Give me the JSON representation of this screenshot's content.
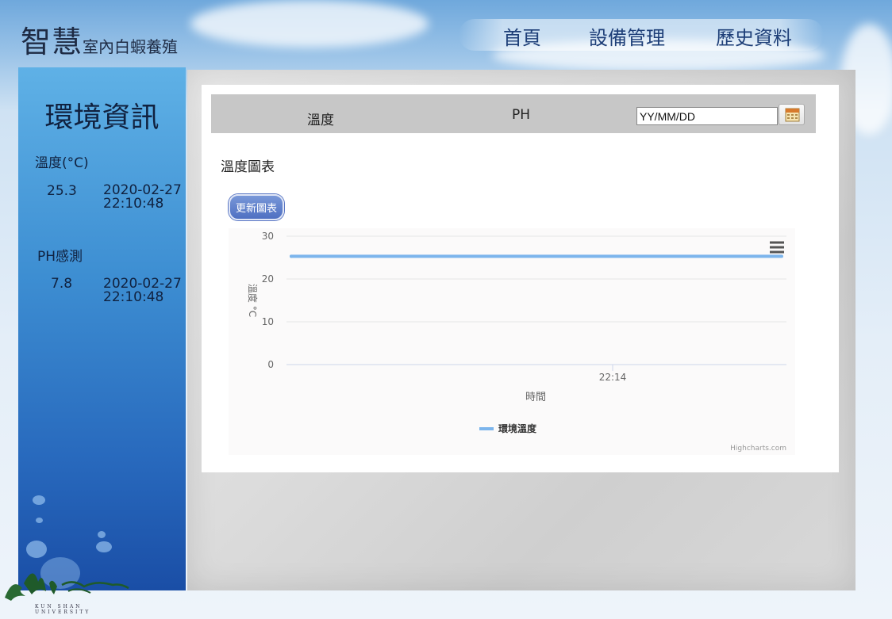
{
  "header": {
    "brand_big": "智慧",
    "brand_small": "室內白蝦養殖",
    "nav": [
      {
        "label": "首頁"
      },
      {
        "label": "設備管理"
      },
      {
        "label": "歷史資料"
      }
    ]
  },
  "sidebar": {
    "title": "環境資訊",
    "temp_label": "溫度(°C)",
    "temp_value": "25.3",
    "temp_date": "2020-02-27",
    "temp_time": "22:10:48",
    "ph_label": "PH感測",
    "ph_value": "7.8",
    "ph_date": "2020-02-27",
    "ph_time": "22:10:48"
  },
  "main": {
    "tabs": [
      {
        "label": "溫度"
      },
      {
        "label": "PH"
      }
    ],
    "date_placeholder": "YY/MM/DD",
    "date_value": "YY/MM/DD",
    "section_title": "溫度圖表",
    "update_button": "更新圖表"
  },
  "chart_data": {
    "type": "line",
    "title": "",
    "xlabel": "時間",
    "ylabel": "溫度 °C",
    "ylim": [
      0,
      30
    ],
    "yticks": [
      "0",
      "10",
      "20",
      "30"
    ],
    "x_tick_label": "22:14",
    "series": [
      {
        "name": "環境溫度",
        "color": "#7cb5ec",
        "values": [
          25.3,
          25.3
        ]
      }
    ],
    "credits": "Highcharts.com",
    "grid": true,
    "legend": "bottom-center"
  },
  "footer": {
    "logo_text": "KUN SHAN UNIVERSITY"
  },
  "colors": {
    "accent": "#4f70c2",
    "series": "#7cb5ec",
    "sidebar_top": "#5fb1e6",
    "sidebar_bottom": "#1a4ea6"
  }
}
